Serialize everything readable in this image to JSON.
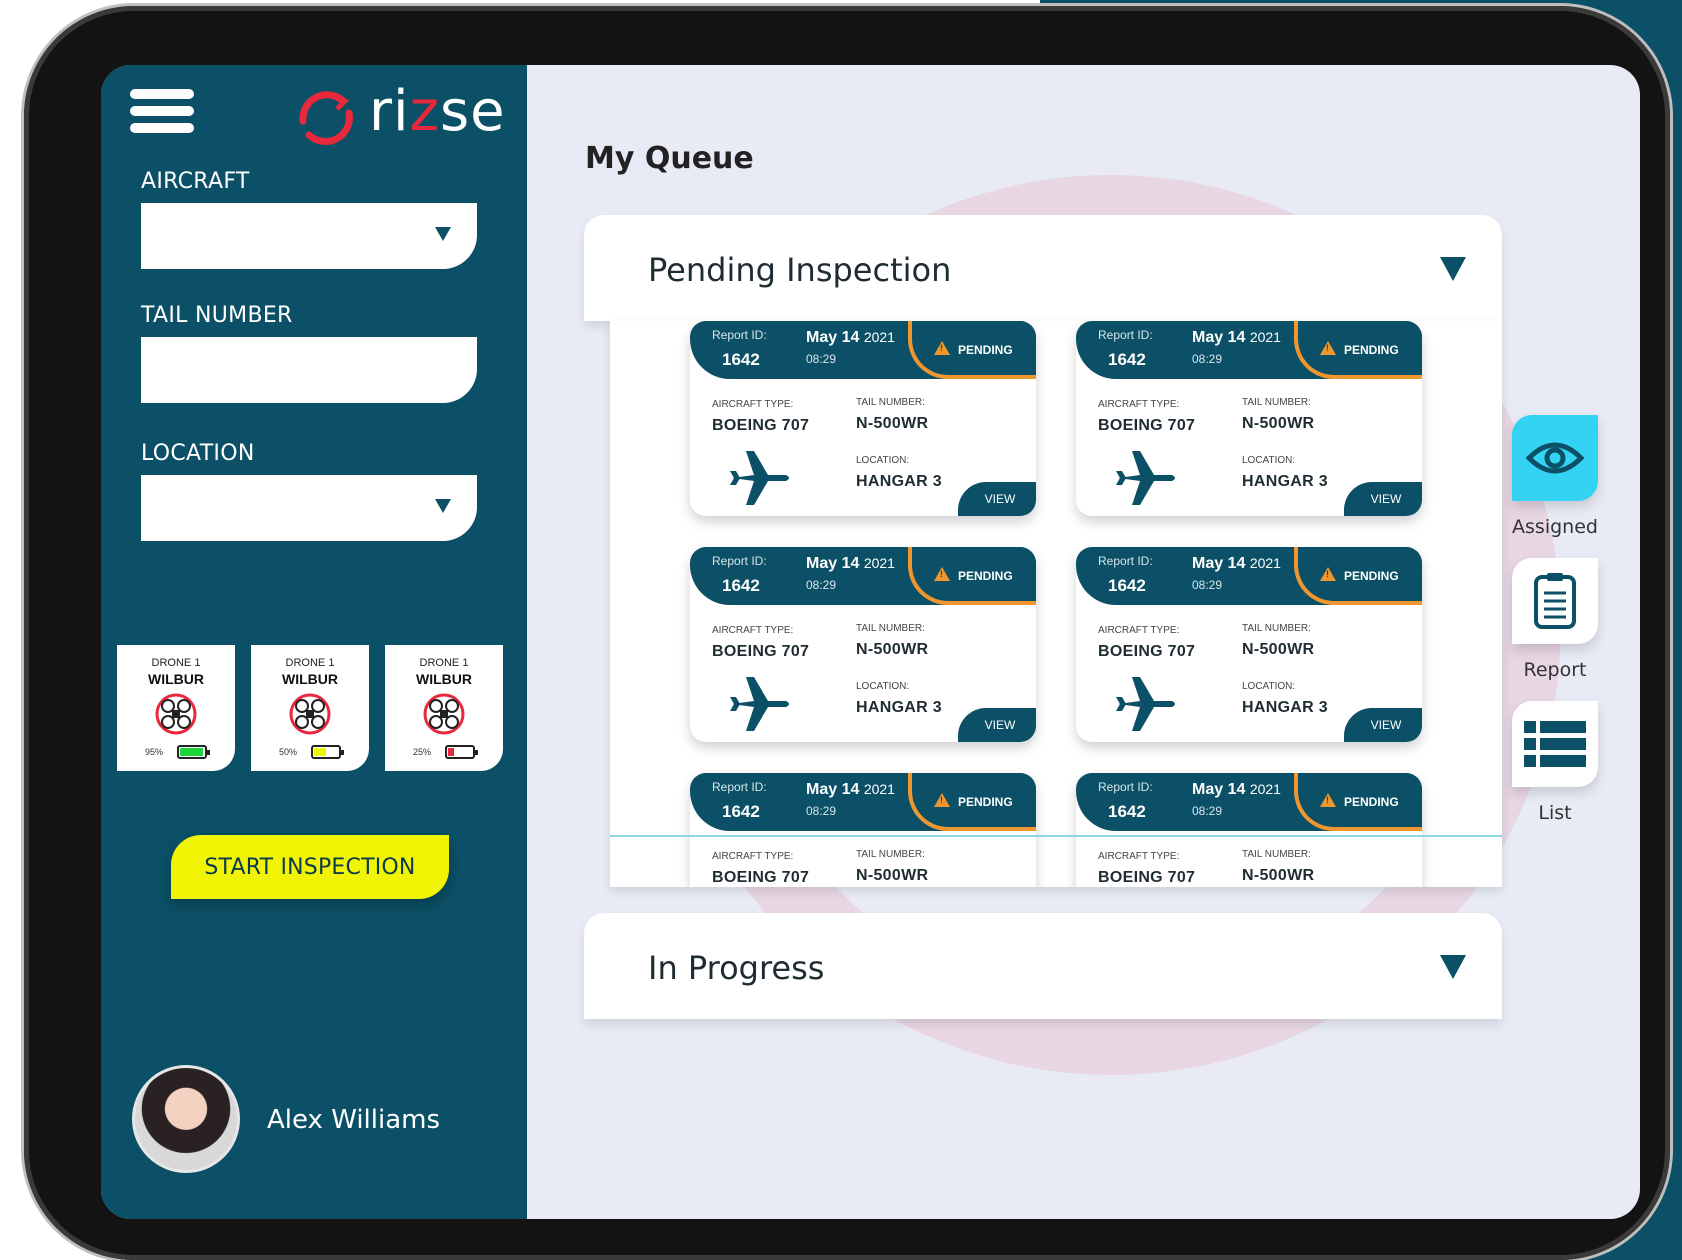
{
  "brand": {
    "logo_text_a": "ri",
    "logo_text_z": "z",
    "logo_text_b": "se"
  },
  "sidebar": {
    "aircraft_label": "AIRCRAFT",
    "aircraft_value": "",
    "tail_label": "TAIL NUMBER",
    "tail_value": "",
    "location_label": "LOCATION",
    "location_value": "",
    "drones": [
      {
        "sub": "DRONE 1",
        "name": "WILBUR",
        "battery_text": "95%",
        "battery_level": 0.95,
        "battery_color": "#1fd63a"
      },
      {
        "sub": "DRONE 1",
        "name": "WILBUR",
        "battery_text": "50%",
        "battery_level": 0.5,
        "battery_color": "#f1f505"
      },
      {
        "sub": "DRONE 1",
        "name": "WILBUR",
        "battery_text": "25%",
        "battery_level": 0.25,
        "battery_color": "#e8283c"
      }
    ],
    "start_button": "START INSPECTION",
    "user_name": "Alex Williams"
  },
  "main": {
    "title": "My Queue",
    "sections": [
      {
        "title": "Pending Inspection",
        "expanded": true
      },
      {
        "title": "In Progress",
        "expanded": false
      }
    ],
    "card_template": {
      "report_label": "Report ID:",
      "report_id": "1642",
      "date": "May 14",
      "year": "2021",
      "time": "08:29",
      "status": "PENDING",
      "aircraft_type_label": "AIRCRAFT TYPE:",
      "aircraft_type": "BOEING 707",
      "tail_label": "TAIL NUMBER:",
      "tail_number": "N-500WR",
      "location_label": "LOCATION:",
      "location": "HANGAR 3",
      "view_label": "VIEW"
    }
  },
  "rail": {
    "assigned": "Assigned",
    "report": "Report",
    "list": "List"
  },
  "colors": {
    "primary": "#0b5066",
    "accent_red": "#e8283c",
    "accent_yellow": "#f1f505",
    "pending_orange": "#f0962e",
    "assigned_cyan": "#35d3f3"
  }
}
